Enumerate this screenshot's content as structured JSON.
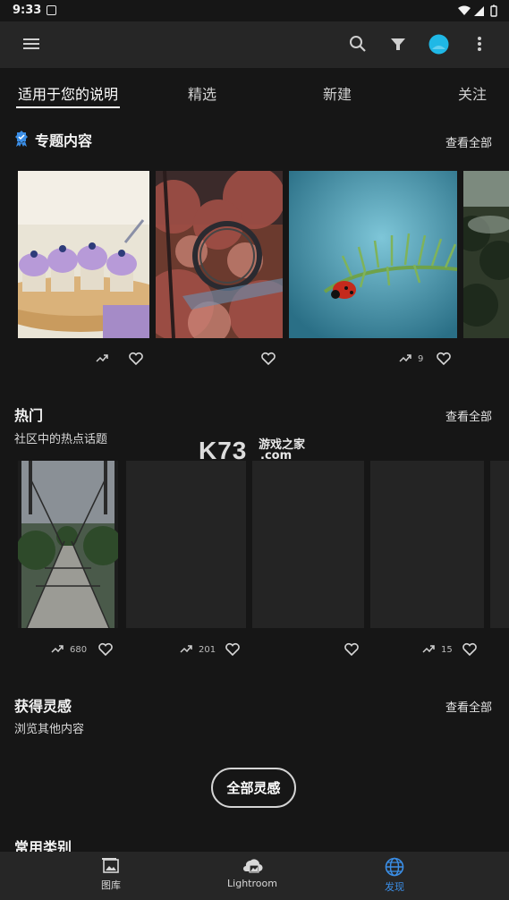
{
  "status_bar": {
    "time": "9:33"
  },
  "tabs": [
    {
      "label": "适用于您的说明",
      "active": true
    },
    {
      "label": "精选"
    },
    {
      "label": "新建"
    },
    {
      "label": "关注"
    }
  ],
  "featured": {
    "title": "专题内容",
    "see_all": "查看全部",
    "items": [
      {
        "subject": "purple-cupcakes",
        "remix_count": ""
      },
      {
        "subject": "autumn-water-wheel",
        "remix_count": ""
      },
      {
        "subject": "ladybug-on-fern",
        "remix_count": "9"
      },
      {
        "subject": "misty-forest",
        "remix_count": ""
      }
    ]
  },
  "trending": {
    "title": "热门",
    "subtitle": "社区中的热点话题",
    "see_all": "查看全部",
    "items": [
      {
        "subject": "suspension-bridge",
        "remix_count": "680"
      },
      {
        "subject": "placeholder",
        "remix_count": "201"
      },
      {
        "subject": "placeholder",
        "remix_count": ""
      },
      {
        "subject": "placeholder",
        "remix_count": "15"
      }
    ]
  },
  "inspiration": {
    "title": "获得灵感",
    "subtitle": "浏览其他内容",
    "see_all": "查看全部",
    "button_label": "全部灵感"
  },
  "categories": {
    "title": "常用类别"
  },
  "watermark": {
    "logo": "K73",
    "text_cn": "游戏之家",
    "text_com": ".com"
  },
  "bottom_nav": [
    {
      "label": "图库",
      "icon": "gallery-icon"
    },
    {
      "label": "Lightroom",
      "icon": "lightroom-icon"
    },
    {
      "label": "发现",
      "icon": "globe-icon",
      "active": true
    }
  ],
  "colors": {
    "accent": "#3b8ee6",
    "avatar": "#1fb8e6",
    "verified_badge": "#3b8ee6"
  }
}
